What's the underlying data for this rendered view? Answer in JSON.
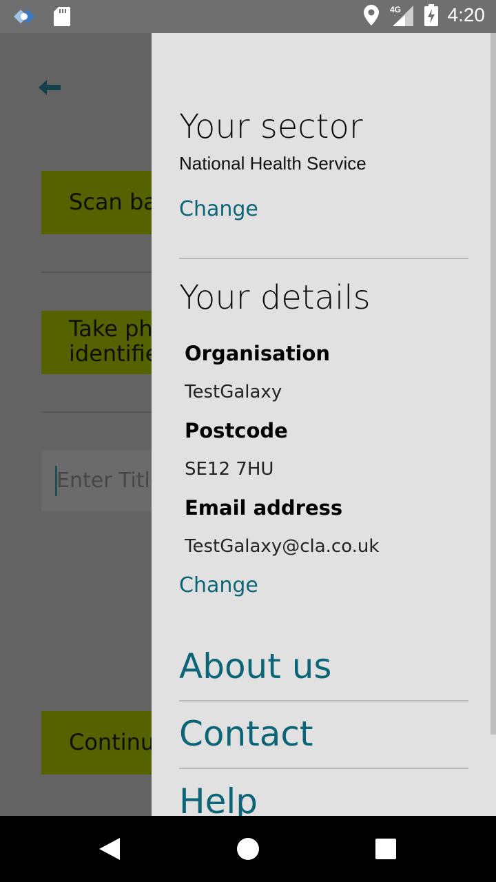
{
  "status_bar": {
    "time": "4:20",
    "network": "4G"
  },
  "app": {
    "scan_button": "Scan ba",
    "take_button": "Take ph\nidentifie",
    "title_placeholder": "Enter Title",
    "continue_button": "Continu",
    "button_color": "#566100"
  },
  "drawer": {
    "sector": {
      "heading": "Your sector",
      "value": "National Health Service",
      "change": "Change"
    },
    "details": {
      "heading": "Your details",
      "organisation_label": "Organisation",
      "organisation_value": "TestGalaxy",
      "postcode_label": "Postcode",
      "postcode_value": "SE12 7HU",
      "email_label": "Email address",
      "email_value": "TestGalaxy@cla.co.uk",
      "change": "Change"
    },
    "links": {
      "about": "About us",
      "contact": "Contact",
      "help": "Help"
    },
    "accent_color": "#0c6577"
  }
}
